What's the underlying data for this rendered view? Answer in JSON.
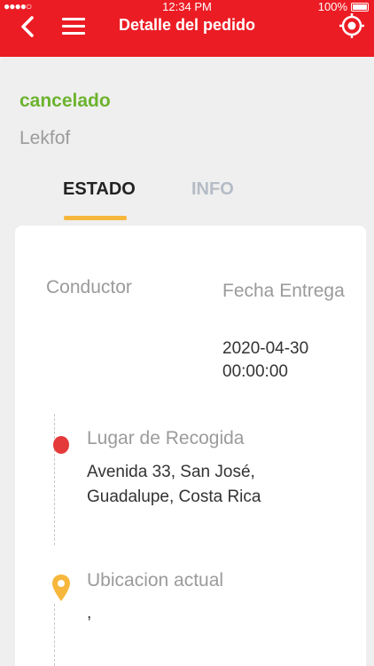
{
  "statusbar": {
    "signal": "●●●●○",
    "time": "12:34 PM",
    "battery": "100%"
  },
  "header": {
    "title": "Detalle del pedido"
  },
  "order": {
    "status": "cancelado",
    "name": "Lekfof"
  },
  "tabs": [
    {
      "label": "ESTADO",
      "active": true
    },
    {
      "label": "INFO",
      "active": false
    }
  ],
  "card": {
    "driver_label": "Conductor",
    "delivery_date_label": "Fecha Entrega",
    "delivery_date_value": "2020-04-30 00:00:00",
    "pickup_label": "Lugar de Recogida",
    "pickup_value": "Avenida 33, San José, Guadalupe, Costa Rica",
    "current_location_label": "Ubicacion actual",
    "current_location_value": ","
  },
  "colors": {
    "header": "#ec1c24",
    "status_green": "#6cb32e",
    "tab_underline": "#f6b73c",
    "pickup_dot": "#e53a3a",
    "location_pin": "#f6b73c"
  }
}
